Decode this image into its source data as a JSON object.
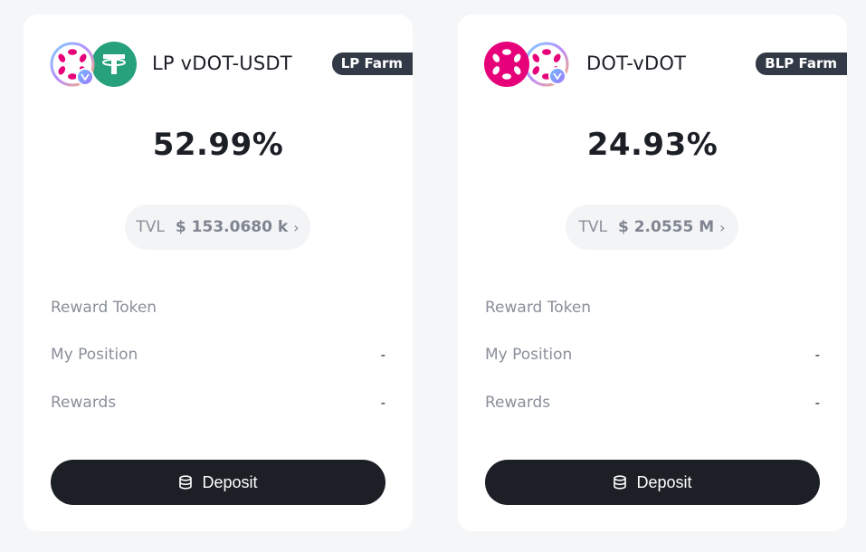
{
  "cards": [
    {
      "pair": "LP vDOT-USDT",
      "tag": "LP Farm",
      "apr": "52.99%",
      "tvl_label": "TVL",
      "tvl_value": "$ 153.0680 k",
      "tvl_chevron": "›",
      "rows": [
        {
          "label": "Reward Token",
          "value": ""
        },
        {
          "label": "My Position",
          "value": "-"
        },
        {
          "label": "Rewards",
          "value": "-"
        }
      ],
      "deposit_label": "Deposit",
      "icons": [
        "vdot-token-icon",
        "usdt-token-icon"
      ]
    },
    {
      "pair": "DOT-vDOT",
      "tag": "BLP Farm",
      "apr": "24.93%",
      "tvl_label": "TVL",
      "tvl_value": "$ 2.0555 M",
      "tvl_chevron": "›",
      "rows": [
        {
          "label": "Reward Token",
          "value": ""
        },
        {
          "label": "My Position",
          "value": "-"
        },
        {
          "label": "Rewards",
          "value": "-"
        }
      ],
      "deposit_label": "Deposit",
      "icons": [
        "dot-token-icon",
        "vdot-token-icon"
      ]
    }
  ],
  "colors": {
    "background": "#f5f6f8",
    "card": "#ffffff",
    "tag_bg": "#323a47",
    "button_bg": "#1c1f26",
    "polkadot_pink": "#e6007a",
    "tether_green": "#26a17b"
  }
}
